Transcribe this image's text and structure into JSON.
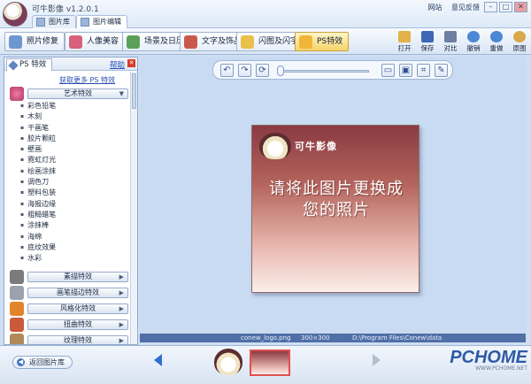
{
  "window": {
    "app_title": "可牛影像 v1.2.0.1",
    "tabs": [
      {
        "label": "图片库"
      },
      {
        "label": "图片编辑"
      }
    ],
    "links": [
      "网站",
      "意见反馈"
    ]
  },
  "toolbar": {
    "function_buttons": [
      {
        "label": "照片修复"
      },
      {
        "label": "人像美容"
      },
      {
        "label": "场景及日历"
      },
      {
        "label": "文字及饰品"
      },
      {
        "label": "闪图及闪字"
      },
      {
        "label": "PS特效"
      }
    ],
    "right_buttons": [
      {
        "label": "打开"
      },
      {
        "label": "保存"
      },
      {
        "label": "对比"
      },
      {
        "label": "撤销"
      },
      {
        "label": "重做"
      },
      {
        "label": "原图"
      }
    ]
  },
  "panel": {
    "tab_label": "PS 特效",
    "help_label": "帮助",
    "more_link": "获取更多 PS 特效",
    "categories": [
      {
        "label": "艺术特效"
      },
      {
        "label": "素描特效"
      },
      {
        "label": "画笔描边特效"
      },
      {
        "label": "风格化特效"
      },
      {
        "label": "扭曲特效"
      },
      {
        "label": "纹理特效"
      }
    ],
    "effects": [
      "彩色铅笔",
      "木刻",
      "干画笔",
      "胶片颗粒",
      "壁画",
      "霓虹灯光",
      "绘画涂抹",
      "调色刀",
      "塑料包装",
      "海报边缘",
      "粗糙蜡笔",
      "涂抹棒",
      "海绵",
      "底纹效果",
      "水彩"
    ]
  },
  "canvas": {
    "brand": "可牛影像",
    "placeholder_text": "请将此图片更换成您的照片"
  },
  "status": {
    "filename": "conew_logo.png",
    "dimensions": "300×300",
    "path": "D:\\Program Files\\Conew\\data"
  },
  "bottom": {
    "back_label": "返回图片库",
    "watermark": "PCHOME",
    "watermark_sub": "WWW.PCHOME.NET"
  },
  "colors": {
    "accent": "#2f6fd0",
    "active_tab": "#f6d36a",
    "status_bar": "#4f6fa6"
  }
}
